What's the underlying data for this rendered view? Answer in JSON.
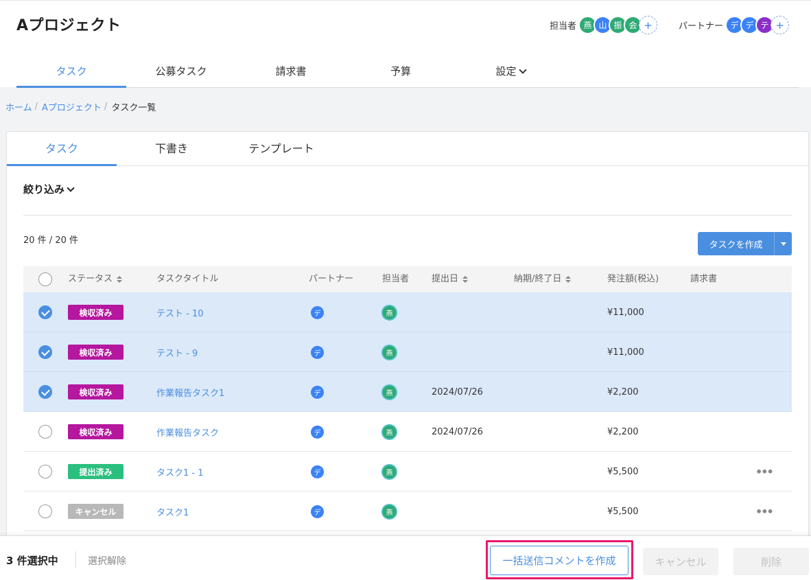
{
  "project": {
    "title": "Aプロジェクト",
    "assignees_label": "担当者",
    "assignees": [
      "燕",
      "山",
      "振",
      "会"
    ],
    "partners_label": "パートナー",
    "partners": [
      "デ",
      "デ",
      "テ"
    ],
    "add_symbol": "+"
  },
  "nav": {
    "tabs": [
      {
        "label": "タスク"
      },
      {
        "label": "公募タスク"
      },
      {
        "label": "請求書"
      },
      {
        "label": "予算"
      },
      {
        "label": "設定"
      }
    ]
  },
  "breadcrumb": {
    "home": "ホーム",
    "project": "Aプロジェクト",
    "current": "タスク一覧",
    "sep": "/"
  },
  "subtabs": [
    {
      "label": "タスク"
    },
    {
      "label": "下書き"
    },
    {
      "label": "テンプレート"
    }
  ],
  "filter_label": "絞り込み",
  "count_text": "20 件 / 20 件",
  "create_button": "タスクを作成",
  "table": {
    "headers": {
      "status": "ステータス",
      "title": "タスクタイトル",
      "partner": "パートナー",
      "assignee": "担当者",
      "submitted": "提出日",
      "due": "納期/終了日",
      "amount": "発注額(税込)",
      "invoice": "請求書"
    },
    "rows": [
      {
        "selected": true,
        "status": "検収済み",
        "status_color": "#b5179e",
        "title": "テスト - 10",
        "partner": "デ",
        "assignee": "燕",
        "submitted": "",
        "amount": "¥11,000",
        "menu": ""
      },
      {
        "selected": true,
        "status": "検収済み",
        "status_color": "#b5179e",
        "title": "テスト - 9",
        "partner": "デ",
        "assignee": "燕",
        "submitted": "",
        "amount": "¥11,000",
        "menu": ""
      },
      {
        "selected": true,
        "status": "検収済み",
        "status_color": "#b5179e",
        "title": "作業報告タスク1",
        "partner": "デ",
        "assignee": "燕",
        "submitted": "2024/07/26",
        "amount": "¥2,200",
        "menu": ""
      },
      {
        "selected": false,
        "status": "検収済み",
        "status_color": "#b5179e",
        "title": "作業報告タスク",
        "partner": "デ",
        "assignee": "燕",
        "submitted": "2024/07/26",
        "amount": "¥2,200",
        "menu": ""
      },
      {
        "selected": false,
        "status": "提出済み",
        "status_color": "#2bbf7f",
        "title": "タスク1 - 1",
        "partner": "デ",
        "assignee": "燕",
        "submitted": "",
        "amount": "¥5,500",
        "menu": "•••"
      },
      {
        "selected": false,
        "status": "キャンセル",
        "status_color": "#b8b8b8",
        "title": "タスク1",
        "partner": "デ",
        "assignee": "燕",
        "submitted": "",
        "amount": "¥5,500",
        "menu": "•••"
      }
    ]
  },
  "bottom_bar": {
    "selected_count": "3 件選択中",
    "clear_selection": "選択解除",
    "bulk_comment": "一括送信コメントを作成",
    "cancel": "キャンセル",
    "delete": "削除"
  }
}
